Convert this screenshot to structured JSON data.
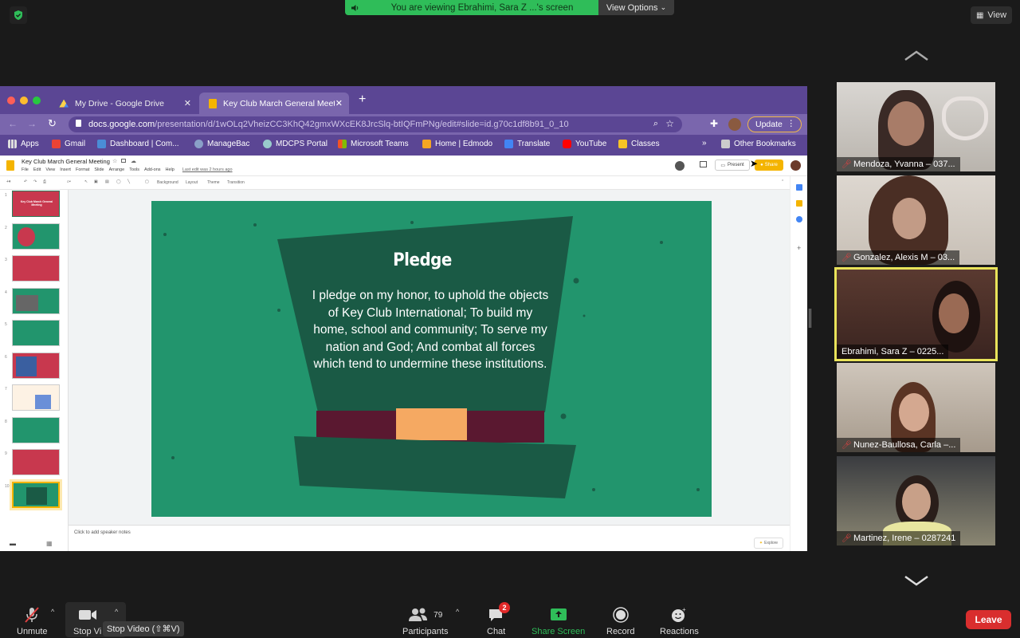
{
  "top": {
    "viewing_banner": "You are viewing Ebrahimi, Sara Z ...'s screen",
    "view_options": "View Options",
    "view_button": "View"
  },
  "browser": {
    "tabs": [
      {
        "label": "My Drive - Google Drive"
      },
      {
        "label": "Key Club March General Meeti"
      }
    ],
    "url_host": "docs.google.com",
    "url_path": "/presentation/d/1wOLq2VheizCC3KhQ42gmxWXcEK8JrcSlq-btIQFmPNg/edit#slide=id.g70c1df8b91_0_10",
    "update_label": "Update",
    "bookmarks": [
      "Apps",
      "Gmail",
      "Dashboard | Com...",
      "ManageBac",
      "MDCPS Portal",
      "Microsoft Teams",
      "Home | Edmodo",
      "Translate",
      "YouTube",
      "Classes"
    ],
    "other_bookmarks": "Other Bookmarks"
  },
  "slides": {
    "doc_title": "Key Club March General Meeting",
    "menu": [
      "File",
      "Edit",
      "View",
      "Insert",
      "Format",
      "Slide",
      "Arrange",
      "Tools",
      "Add-ons",
      "Help"
    ],
    "last_edit": "Last edit was 2 hours ago",
    "present_label": "Present",
    "share_label": "Share",
    "toolbar_items": [
      "Background",
      "Layout",
      "Theme",
      "Transition"
    ],
    "thumb_numbers": [
      "1",
      "2",
      "3",
      "4",
      "5",
      "6",
      "7",
      "8",
      "9",
      "10"
    ],
    "thumb_titles": [
      "Key Club March General Meeting"
    ],
    "notes_placeholder": "Click to add speaker notes",
    "explore_label": "Explore",
    "slide_title": "Pledge",
    "slide_body": "I pledge on my honor, to uphold the objects of Key Club International; To build my home, school and community; To serve my nation and God; And combat all forces which tend to undermine these institutions.",
    "colors": {
      "slide_bg": "#22956d",
      "hat": "#1a5a45",
      "band": "#5a1830",
      "buckle": "#f5a962"
    }
  },
  "participants_tiles": [
    {
      "name": "Mendoza, Yvanna – 037...",
      "muted": true
    },
    {
      "name": "Gonzalez, Alexis M – 03...",
      "muted": true
    },
    {
      "name": "Ebrahimi, Sara Z – 0225...",
      "muted": false,
      "active": true
    },
    {
      "name": "Nunez-Baullosa, Carla –...",
      "muted": true
    },
    {
      "name": "Martinez, Irene – 0287241",
      "muted": true
    }
  ],
  "controls": {
    "unmute": "Unmute",
    "stop_video": "Stop Vi",
    "stop_video_tooltip": "Stop Video (⇧⌘V)",
    "participants": "Participants",
    "participants_count": "79",
    "chat": "Chat",
    "chat_badge": "2",
    "share_screen": "Share Screen",
    "record": "Record",
    "reactions": "Reactions",
    "leave": "Leave"
  }
}
